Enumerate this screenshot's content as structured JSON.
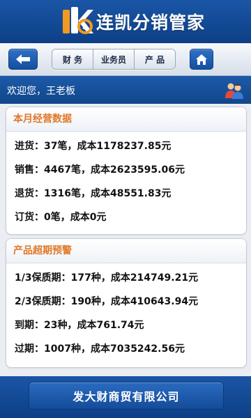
{
  "header": {
    "app_name": "连凯分销管家"
  },
  "nav": {
    "back_icon": "back-arrow-icon",
    "tabs": [
      {
        "label": "财 务"
      },
      {
        "label": "业务员"
      },
      {
        "label": "产 品"
      }
    ],
    "home_icon": "home-icon"
  },
  "welcome": {
    "text": "欢迎您，王老板",
    "icon": "users-icon"
  },
  "monthly": {
    "title": "本月经营数据",
    "rows": [
      "进货：37笔，成本1178237.85元",
      "销售：4467笔，成本2623595.06元",
      "退货：1316笔，成本48551.83元",
      "订货：0笔，成本0元"
    ]
  },
  "warning": {
    "title": "产品超期预警",
    "rows": [
      "1/3保质期：177种，成本214749.21元",
      "2/3保质期：190种，成本410643.94元",
      "到期：23种，成本761.74元",
      "过期：1007种，成本7035242.56元"
    ]
  },
  "footer": {
    "company": "发大财商贸有限公司"
  },
  "colors": {
    "header_blue": "#1a56a6",
    "section_title": "#e0782a"
  }
}
